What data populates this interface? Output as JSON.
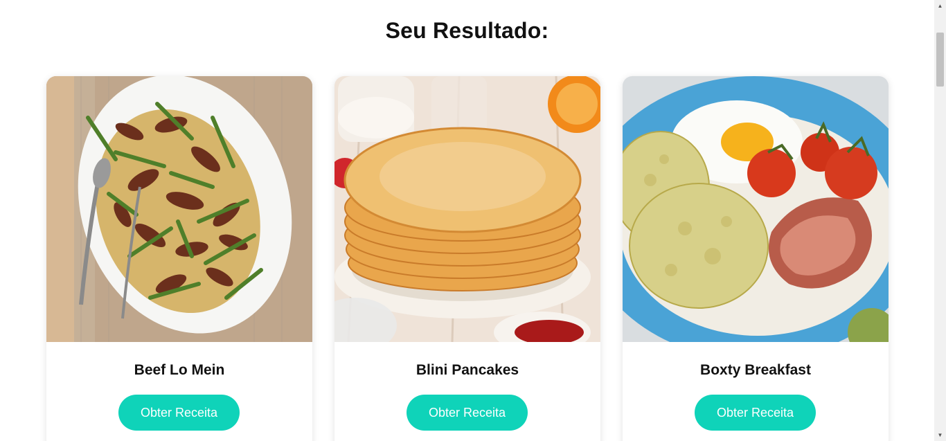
{
  "heading": "Seu Resultado:",
  "accent_color": "#0fd3b9",
  "recipes": [
    {
      "name": "Beef Lo Mein",
      "button_label": "Obter Receita",
      "image": "beef-lo-mein-photo"
    },
    {
      "name": "Blini Pancakes",
      "button_label": "Obter Receita",
      "image": "blini-pancakes-photo"
    },
    {
      "name": "Boxty Breakfast",
      "button_label": "Obter Receita",
      "image": "boxty-breakfast-photo"
    }
  ]
}
